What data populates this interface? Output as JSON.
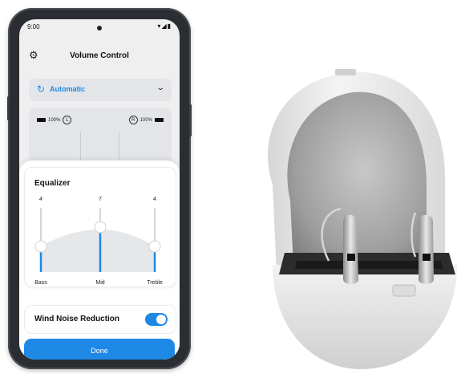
{
  "status_bar": {
    "time": "9:00",
    "icons": "▾◢▮"
  },
  "app": {
    "title": "Volume Control",
    "settings_icon": "gear-icon",
    "program": {
      "selected": "Automatic",
      "icon": "refresh-icon"
    }
  },
  "volume": {
    "left": {
      "battery": "100%",
      "side": "L"
    },
    "right": {
      "battery": "100%",
      "side": "R"
    }
  },
  "equalizer": {
    "title": "Equalizer",
    "bands": [
      {
        "label": "Bass",
        "value": "4",
        "level": 4
      },
      {
        "label": "Mid",
        "value": "7",
        "level": 7
      },
      {
        "label": "Treble",
        "value": "4",
        "level": 4
      }
    ],
    "max_level": 10
  },
  "wind_noise": {
    "label": "Wind Noise Reduction",
    "enabled": true
  },
  "done_button": {
    "label": "Done"
  },
  "colors": {
    "accent": "#1e88e5",
    "screen_bg": "#efefef",
    "case": "#e9e9e9"
  }
}
